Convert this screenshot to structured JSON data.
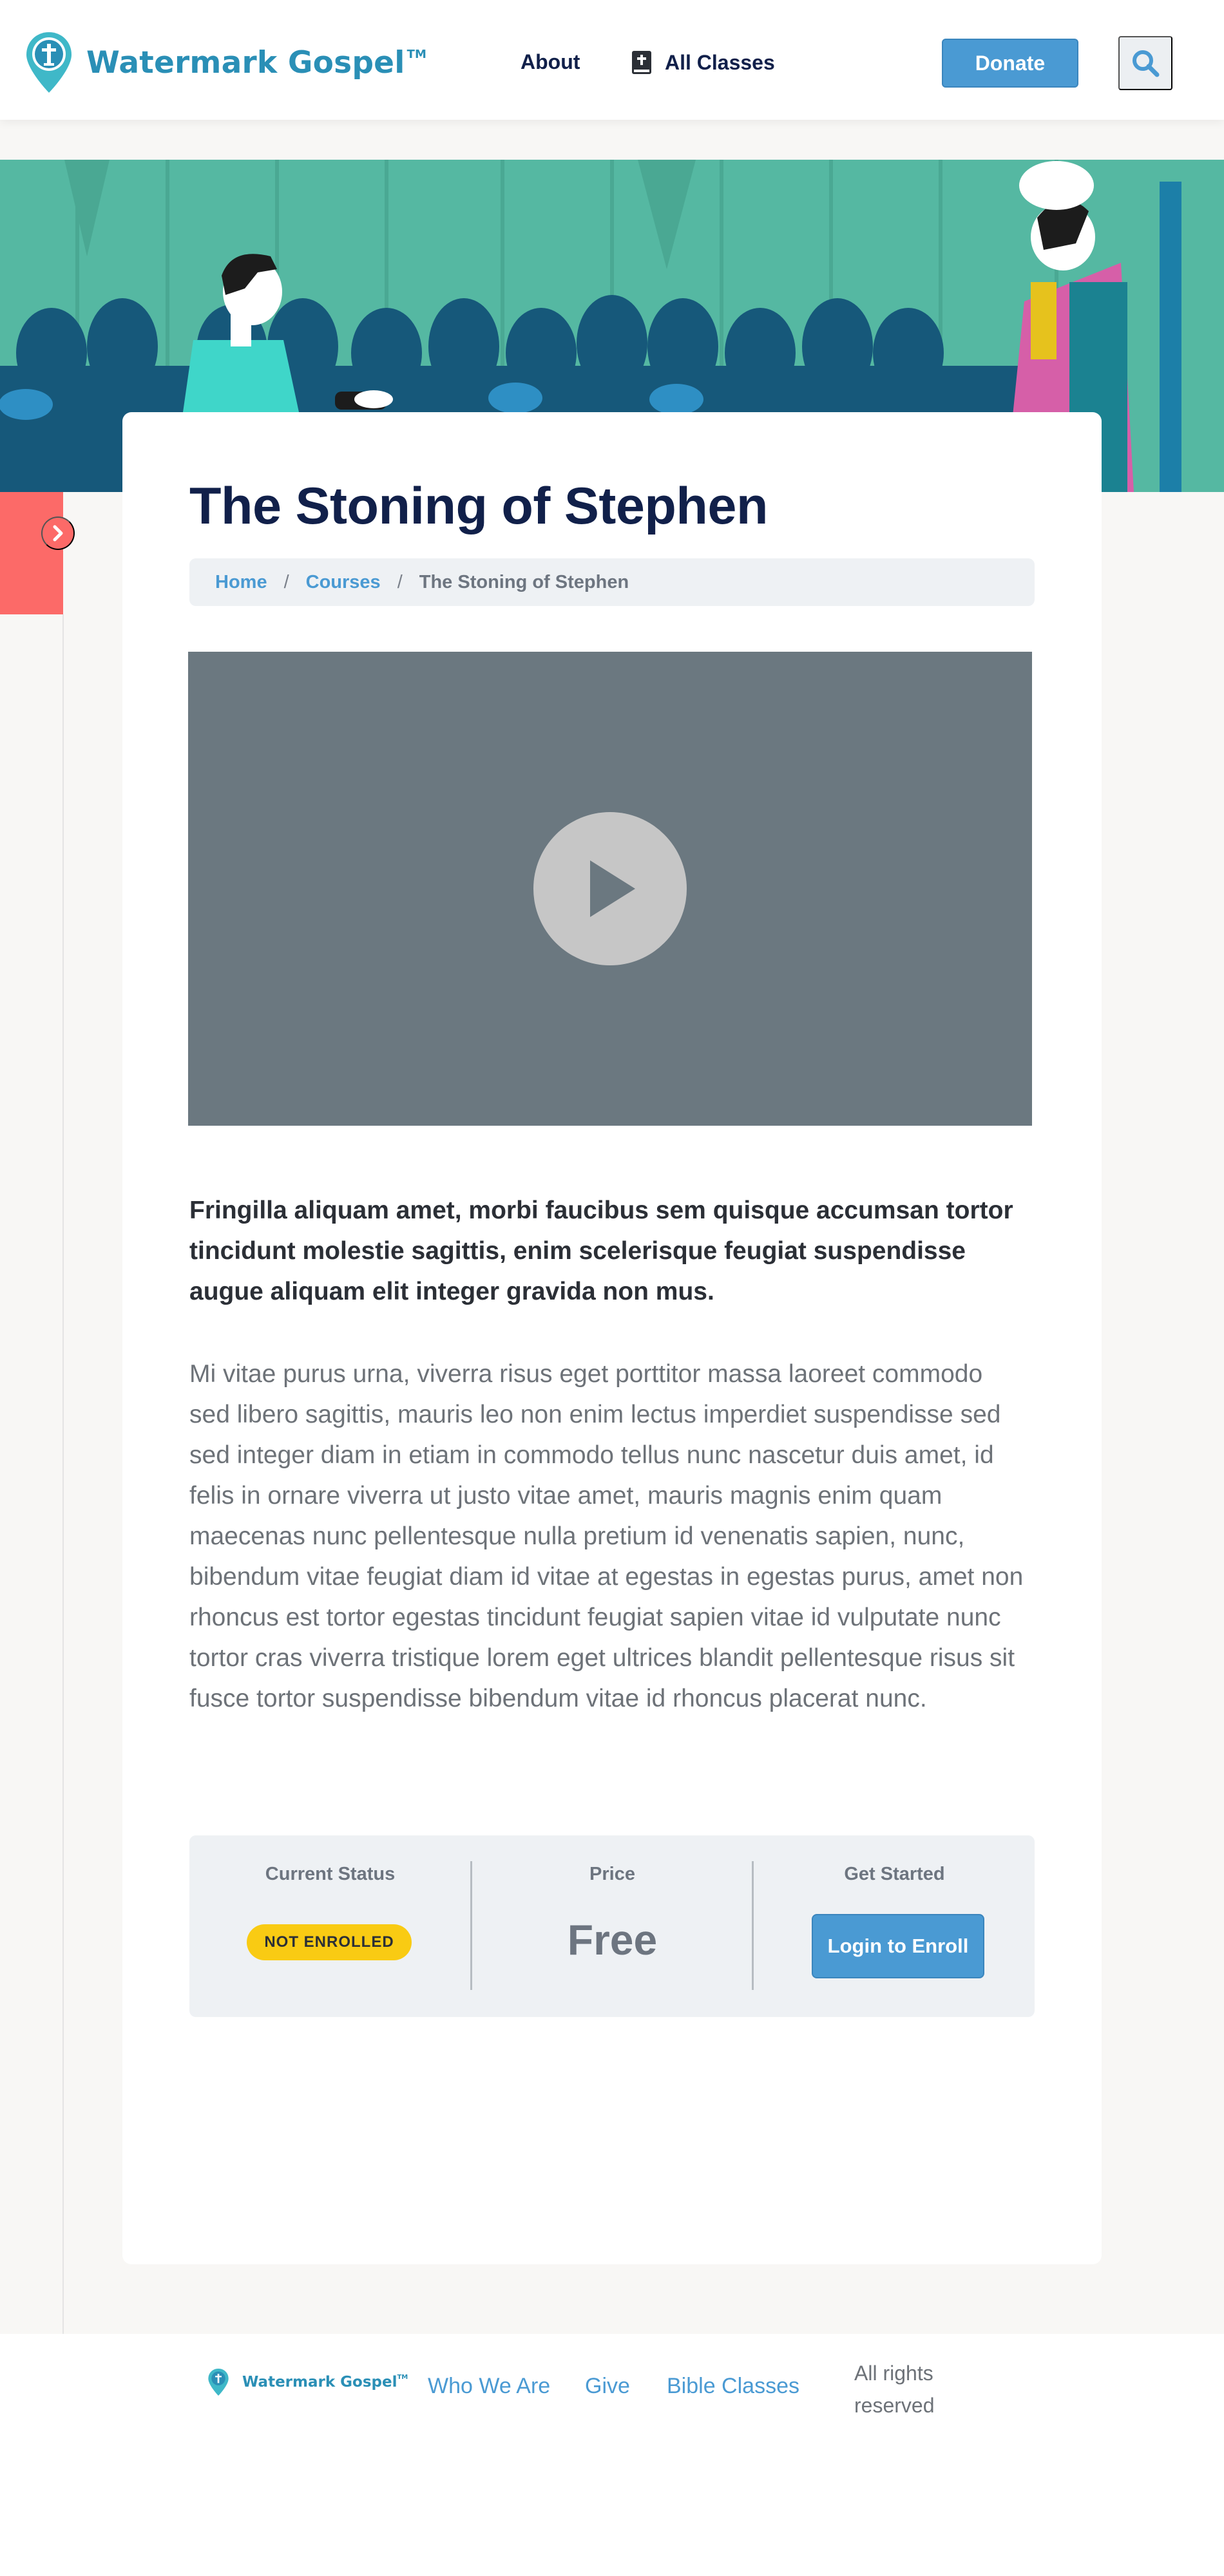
{
  "header": {
    "logo_text": "Watermark Gospel",
    "logo_tm": "TM",
    "nav": {
      "about": "About",
      "all_classes": "All Classes"
    },
    "donate_label": "Donate"
  },
  "course": {
    "title": "The Stoning of Stephen",
    "breadcrumb": [
      "Home",
      "Courses",
      "The Stoning of Stephen"
    ],
    "lead": "Fringilla aliquam amet, morbi faucibus sem quisque accumsan tortor tincidunt molestie sagittis, enim scelerisque feugiat suspendisse augue aliquam elit integer gravida non mus.",
    "body": "Mi vitae purus urna, viverra risus eget porttitor massa laoreet commodo sed libero sagittis, mauris leo non enim lectus imperdiet suspendisse sed sed integer diam in etiam in commodo tellus nunc nascetur duis amet, id felis in ornare viverra ut justo vitae amet, mauris magnis enim quam maecenas nunc pellentesque nulla pretium id venenatis sapien, nunc, bibendum vitae feugiat diam id vitae at egestas in egestas purus, amet non rhoncus est tortor egestas tincidunt feugiat sapien vitae id vulputate nunc tortor cras viverra tristique lorem eget ultrices blandit pellentesque risus sit fusce tortor suspendisse bibendum vitae id rhoncus placerat nunc."
  },
  "enroll": {
    "status_label": "Current Status",
    "status_value": "NOT ENROLLED",
    "price_label": "Price",
    "price_value": "Free",
    "start_label": "Get Started",
    "start_button": "Login to Enroll"
  },
  "footer": {
    "logo_text": "Watermark Gospel",
    "logo_tm": "TM",
    "links": [
      "Who We Are",
      "Give",
      "Bible Classes"
    ],
    "rights_line1": "All rights",
    "rights_line2": "reserved"
  },
  "icons": {
    "logo": "map-pin-cross-icon",
    "classes": "book-icon",
    "search": "search-icon",
    "sidebar_toggle": "chevron-right-icon",
    "video": "play-icon"
  },
  "colors": {
    "brand": "#2a8fb6",
    "primary_button": "#4a9ad3",
    "heading": "#11204a",
    "accent_red": "#fc6a68",
    "badge_yellow": "#f9cb13",
    "video_bg": "#6b7880"
  }
}
